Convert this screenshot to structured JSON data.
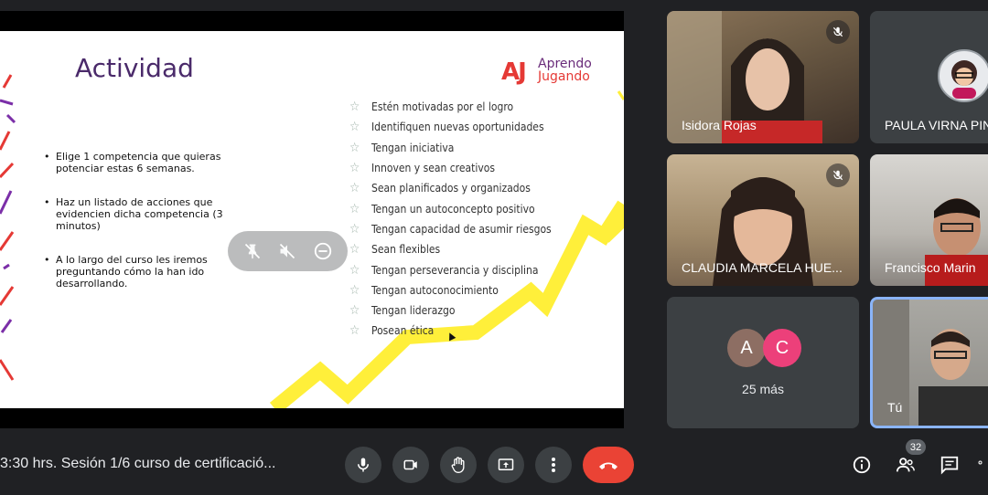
{
  "slide": {
    "title": "Actividad",
    "logo": {
      "mark": "AJ",
      "line1": "Aprendo",
      "line2": "Jugando"
    },
    "bullets": [
      "Elige 1 competencia que quieras potenciar estas 6 semanas.",
      "Haz un listado de acciones que evidencien dicha competencia (3 minutos)",
      "A lo largo del curso les iremos preguntando cómo la han ido desarrollando."
    ],
    "traits": [
      "Estén motivadas por el logro",
      "Identifiquen nuevas oportunidades",
      "Tengan iniciativa",
      "Innoven y sean creativos",
      "Sean planificados y organizados",
      "Tengan un autoconcepto positivo",
      "Tengan capacidad de asumir riesgos",
      "Sean flexibles",
      "Tengan perseverancia y disciplina",
      "Tengan autoconocimiento",
      "Tengan liderazgo",
      "Posean ética"
    ]
  },
  "overlay_icons": [
    "pin-off-icon",
    "mute-off-icon",
    "remove-icon"
  ],
  "participants": [
    {
      "name": "Isidora Rojas",
      "muted": true
    },
    {
      "name": "PAULA VIRNA PIN",
      "muted": false
    },
    {
      "name": "CLAUDIA MARCELA HUE...",
      "muted": true
    },
    {
      "name": "Francisco Marin",
      "muted": false
    },
    {
      "name": "Tú",
      "muted": false
    }
  ],
  "others": {
    "avatars": [
      {
        "letter": "A",
        "color": "#8d6e63"
      },
      {
        "letter": "C",
        "color": "#ec407a"
      }
    ],
    "label": "25 más"
  },
  "meeting_title": "3:30 hrs. Sesión 1/6 curso de certificació...",
  "people_count": "32",
  "colors": {
    "accent": "#8ab4f8",
    "end_call": "#ea4335",
    "tile": "#3c4043",
    "bg": "#202124"
  }
}
